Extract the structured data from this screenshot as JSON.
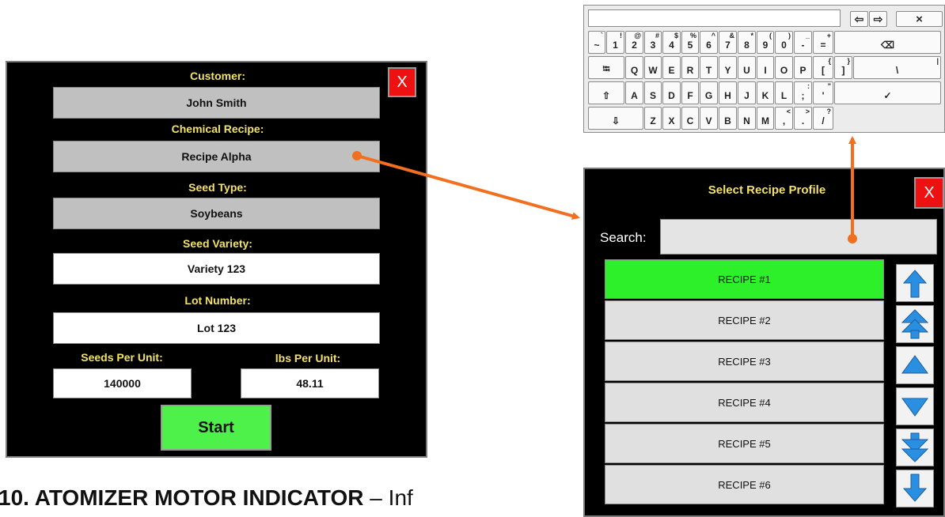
{
  "job_setup": {
    "customer_label": "Customer:",
    "customer_value": "John Smith",
    "recipe_label": "Chemical Recipe:",
    "recipe_value": "Recipe Alpha",
    "seed_type_label": "Seed Type:",
    "seed_type_value": "Soybeans",
    "seed_variety_label": "Seed Variety:",
    "seed_variety_value": "Variety 123",
    "lot_label": "Lot Number:",
    "lot_value": "Lot 123",
    "seeds_per_unit_label": "Seeds Per Unit:",
    "seeds_per_unit_value": "140000",
    "lbs_per_unit_label": "lbs Per Unit:",
    "lbs_per_unit_value": "48.11",
    "start_label": "Start",
    "close_label": "X"
  },
  "keyboard": {
    "nav_keys": [
      "⇦",
      "⇨",
      "×"
    ],
    "row1": [
      {
        "main": "~",
        "sup": "`"
      },
      {
        "main": "1",
        "sup": "!"
      },
      {
        "main": "2",
        "sup": "@"
      },
      {
        "main": "3",
        "sup": "#"
      },
      {
        "main": "4",
        "sup": "$"
      },
      {
        "main": "5",
        "sup": "%"
      },
      {
        "main": "6",
        "sup": "^"
      },
      {
        "main": "7",
        "sup": "&"
      },
      {
        "main": "8",
        "sup": "*"
      },
      {
        "main": "9",
        "sup": "("
      },
      {
        "main": "0",
        "sup": ")"
      },
      {
        "main": "-",
        "sup": "_"
      },
      {
        "main": "=",
        "sup": "+"
      },
      {
        "main": "⌫",
        "sup": ""
      }
    ],
    "row2": [
      {
        "main": "⭾",
        "sup": ""
      },
      {
        "main": "Q",
        "sup": ""
      },
      {
        "main": "W",
        "sup": ""
      },
      {
        "main": "E",
        "sup": ""
      },
      {
        "main": "R",
        "sup": ""
      },
      {
        "main": "T",
        "sup": ""
      },
      {
        "main": "Y",
        "sup": ""
      },
      {
        "main": "U",
        "sup": ""
      },
      {
        "main": "I",
        "sup": ""
      },
      {
        "main": "O",
        "sup": ""
      },
      {
        "main": "P",
        "sup": ""
      },
      {
        "main": "[",
        "sup": "{"
      },
      {
        "main": "]",
        "sup": "}"
      },
      {
        "main": "\\",
        "sup": "|"
      }
    ],
    "row3": [
      {
        "main": "⇧",
        "sup": ""
      },
      {
        "main": "A",
        "sup": ""
      },
      {
        "main": "S",
        "sup": ""
      },
      {
        "main": "D",
        "sup": ""
      },
      {
        "main": "F",
        "sup": ""
      },
      {
        "main": "G",
        "sup": ""
      },
      {
        "main": "H",
        "sup": ""
      },
      {
        "main": "J",
        "sup": ""
      },
      {
        "main": "K",
        "sup": ""
      },
      {
        "main": "L",
        "sup": ""
      },
      {
        "main": ";",
        "sup": ":"
      },
      {
        "main": "'",
        "sup": "\""
      },
      {
        "main": "✓",
        "sup": ""
      }
    ],
    "row4": [
      {
        "main": "⇩",
        "sup": ""
      },
      {
        "main": "Z",
        "sup": ""
      },
      {
        "main": "X",
        "sup": ""
      },
      {
        "main": "C",
        "sup": ""
      },
      {
        "main": "V",
        "sup": ""
      },
      {
        "main": "B",
        "sup": ""
      },
      {
        "main": "N",
        "sup": ""
      },
      {
        "main": "M",
        "sup": ""
      },
      {
        "main": ",",
        "sup": "<"
      },
      {
        "main": ".",
        "sup": ">"
      },
      {
        "main": "/",
        "sup": "?"
      }
    ]
  },
  "recipe_selector": {
    "title": "Select Recipe Profile",
    "close_label": "X",
    "search_label": "Search:",
    "search_value": "",
    "items": [
      "RECIPE #1",
      "RECIPE #2",
      "RECIPE #3",
      "RECIPE #4",
      "RECIPE #5",
      "RECIPE #6"
    ],
    "selected_index": 0,
    "scroll_icons": [
      "arrow-top-icon",
      "page-up-icon",
      "line-up-icon",
      "line-down-icon",
      "page-down-icon",
      "arrow-bottom-icon"
    ]
  },
  "colors": {
    "panel_bg": "#000000",
    "label_yellow": "#f3e26a",
    "close_red": "#ee1111",
    "start_green": "#4ef04a",
    "selected_green": "#2df02a",
    "arrow_orange": "#f07020",
    "scroll_blue": "#2a8fe0"
  },
  "page": {
    "heading_number": "10.",
    "heading_text": "ATOMIZER MOTOR INDICATOR",
    "heading_rest": " – Inf"
  }
}
